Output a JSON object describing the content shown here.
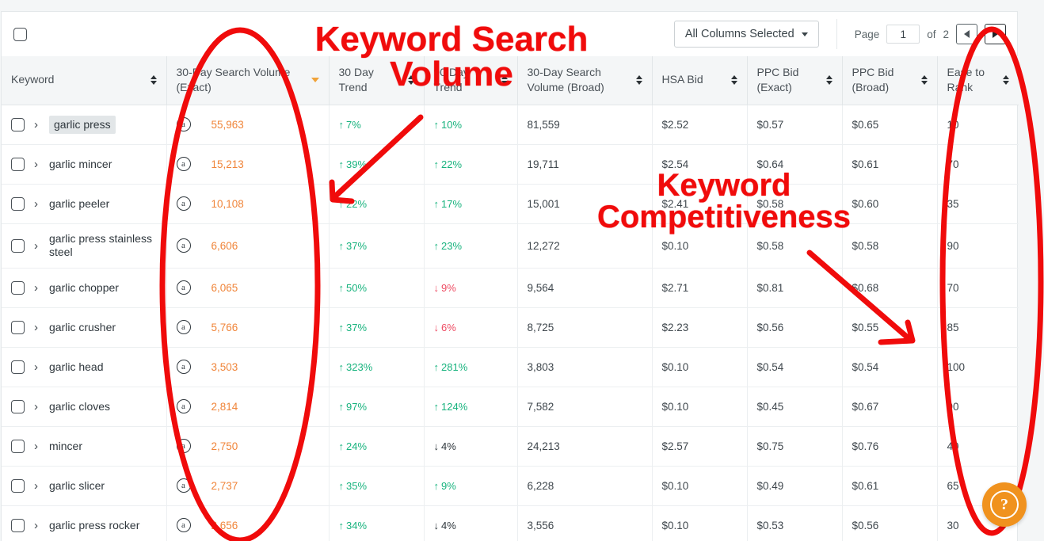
{
  "toolbar": {
    "select_all_checkbox": "",
    "columns_select_label": "All Columns Selected",
    "page_label": "Page",
    "page_value": "1",
    "of_label": "of",
    "page_total": "2",
    "prev_icon": "triangle-left-icon",
    "next_icon": "triangle-right-icon"
  },
  "table": {
    "columns": [
      {
        "label": "Keyword",
        "sort": "both"
      },
      {
        "label": "30-Day Search Volume (Exact)",
        "sort": "desc-active"
      },
      {
        "label": "30 Day Trend",
        "sort": "both"
      },
      {
        "label": "90 Day Trend",
        "sort": "both"
      },
      {
        "label": "30-Day Search Volume (Broad)",
        "sort": "both"
      },
      {
        "label": "HSA Bid",
        "sort": "both"
      },
      {
        "label": "PPC Bid (Exact)",
        "sort": "both"
      },
      {
        "label": "PPC Bid (Broad)",
        "sort": "both"
      },
      {
        "label": "Ease to Rank",
        "sort": "both"
      }
    ],
    "rows": [
      {
        "keyword": "garlic press",
        "highlighted": true,
        "source_icon": "amazon-icon",
        "vol_exact": "55,963",
        "trend30": {
          "dir": "up",
          "value": "7%"
        },
        "trend90": {
          "dir": "up",
          "value": "10%"
        },
        "vol_broad": "81,559",
        "hsa_bid": "$2.52",
        "ppc_exact": "$0.57",
        "ppc_broad": "$0.65",
        "ease_to_rank": "10"
      },
      {
        "keyword": "garlic mincer",
        "highlighted": false,
        "source_icon": "amazon-icon",
        "vol_exact": "15,213",
        "trend30": {
          "dir": "up",
          "value": "39%"
        },
        "trend90": {
          "dir": "up",
          "value": "22%"
        },
        "vol_broad": "19,711",
        "hsa_bid": "$2.54",
        "ppc_exact": "$0.64",
        "ppc_broad": "$0.61",
        "ease_to_rank": "70"
      },
      {
        "keyword": "garlic peeler",
        "highlighted": false,
        "source_icon": "amazon-icon",
        "vol_exact": "10,108",
        "trend30": {
          "dir": "up",
          "value": "22%"
        },
        "trend90": {
          "dir": "up",
          "value": "17%"
        },
        "vol_broad": "15,001",
        "hsa_bid": "$2.41",
        "ppc_exact": "$0.58",
        "ppc_broad": "$0.60",
        "ease_to_rank": "35"
      },
      {
        "keyword": "garlic press stainless steel",
        "highlighted": false,
        "source_icon": "amazon-icon",
        "vol_exact": "6,606",
        "trend30": {
          "dir": "up",
          "value": "37%"
        },
        "trend90": {
          "dir": "up",
          "value": "23%"
        },
        "vol_broad": "12,272",
        "hsa_bid": "$0.10",
        "ppc_exact": "$0.58",
        "ppc_broad": "$0.58",
        "ease_to_rank": "90"
      },
      {
        "keyword": "garlic chopper",
        "highlighted": false,
        "source_icon": "amazon-icon",
        "vol_exact": "6,065",
        "trend30": {
          "dir": "up",
          "value": "50%"
        },
        "trend90": {
          "dir": "down",
          "value": "9%"
        },
        "vol_broad": "9,564",
        "hsa_bid": "$2.71",
        "ppc_exact": "$0.81",
        "ppc_broad": "$0.68",
        "ease_to_rank": "70"
      },
      {
        "keyword": "garlic crusher",
        "highlighted": false,
        "source_icon": "amazon-icon",
        "vol_exact": "5,766",
        "trend30": {
          "dir": "up",
          "value": "37%"
        },
        "trend90": {
          "dir": "down",
          "value": "6%"
        },
        "vol_broad": "8,725",
        "hsa_bid": "$2.23",
        "ppc_exact": "$0.56",
        "ppc_broad": "$0.55",
        "ease_to_rank": "85"
      },
      {
        "keyword": "garlic head",
        "highlighted": false,
        "source_icon": "amazon-icon",
        "vol_exact": "3,503",
        "trend30": {
          "dir": "up",
          "value": "323%"
        },
        "trend90": {
          "dir": "up",
          "value": "281%"
        },
        "vol_broad": "3,803",
        "hsa_bid": "$0.10",
        "ppc_exact": "$0.54",
        "ppc_broad": "$0.54",
        "ease_to_rank": "100"
      },
      {
        "keyword": "garlic cloves",
        "highlighted": false,
        "source_icon": "amazon-icon",
        "vol_exact": "2,814",
        "trend30": {
          "dir": "up",
          "value": "97%"
        },
        "trend90": {
          "dir": "up",
          "value": "124%"
        },
        "vol_broad": "7,582",
        "hsa_bid": "$0.10",
        "ppc_exact": "$0.45",
        "ppc_broad": "$0.67",
        "ease_to_rank": "90"
      },
      {
        "keyword": "mincer",
        "highlighted": false,
        "source_icon": "amazon-icon",
        "vol_exact": "2,750",
        "trend30": {
          "dir": "up",
          "value": "24%"
        },
        "trend90": {
          "dir": "flat",
          "value": "4%"
        },
        "vol_broad": "24,213",
        "hsa_bid": "$2.57",
        "ppc_exact": "$0.75",
        "ppc_broad": "$0.76",
        "ease_to_rank": "40"
      },
      {
        "keyword": "garlic slicer",
        "highlighted": false,
        "source_icon": "amazon-icon",
        "vol_exact": "2,737",
        "trend30": {
          "dir": "up",
          "value": "35%"
        },
        "trend90": {
          "dir": "up",
          "value": "9%"
        },
        "vol_broad": "6,228",
        "hsa_bid": "$0.10",
        "ppc_exact": "$0.49",
        "ppc_broad": "$0.61",
        "ease_to_rank": "65"
      },
      {
        "keyword": "garlic press rocker",
        "highlighted": false,
        "source_icon": "amazon-icon",
        "vol_exact": "2,656",
        "trend30": {
          "dir": "up",
          "value": "34%"
        },
        "trend90": {
          "dir": "flat",
          "value": "4%"
        },
        "vol_broad": "3,556",
        "hsa_bid": "$0.10",
        "ppc_exact": "$0.53",
        "ppc_broad": "$0.56",
        "ease_to_rank": "30"
      }
    ]
  },
  "annotations": {
    "keyword_search_volume": "Keyword Search Volume",
    "keyword_competitiveness": "Keyword Competitiveness",
    "color": "#f00b0b"
  },
  "help": {
    "icon": "question-mark-icon",
    "label": "?"
  }
}
